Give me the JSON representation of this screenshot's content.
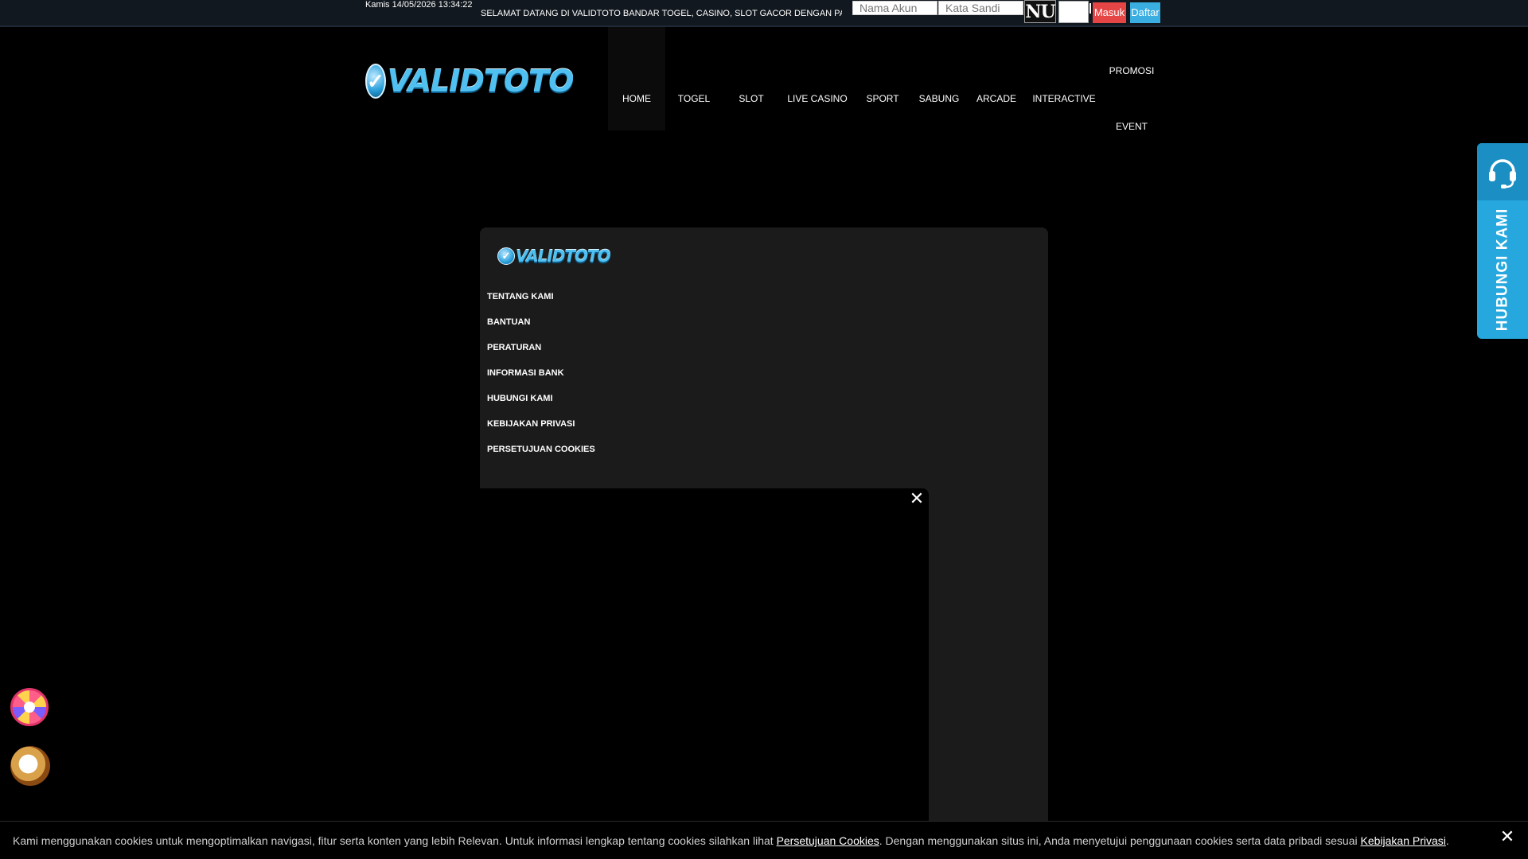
{
  "topbar": {
    "datetime": "Kamis 14/05/2026 13:34:22",
    "datetime_icon": "",
    "announcement": "SELAMAT DATANG DI VALIDTOTO BANDAR TOGEL, CASINO, SLOT GACOR DENGAN PASARAN TERLENGKAP",
    "username_placeholder": "Nama Akun",
    "password_placeholder": "Kata Sandi",
    "captcha_text": "NU",
    "login_label": "Masuk",
    "register_label": "Daftar"
  },
  "brand": {
    "logo_text": "VALIDTOTO"
  },
  "nav": {
    "items": [
      "HOME",
      "TOGEL",
      "SLOT",
      "LIVE CASINO",
      "SPORT",
      "SABUNG",
      "ARCADE",
      "INTERACTIVE",
      "PROMOSI",
      "EVENT"
    ]
  },
  "modal": {
    "logo_text": "VALIDTOTO",
    "menu": [
      "TENTANG KAMI",
      "BANTUAN",
      "PERATURAN",
      "INFORMASI BANK",
      "HUBUNGI KAMI",
      "KEBIJAKAN PRIVASI",
      "PERSETUJUAN COOKIES"
    ],
    "video_close": "✕"
  },
  "contact": {
    "label": "HUBUNGI KAMI",
    "icon": "headset-icon"
  },
  "cookie": {
    "text_1": "Kami menggunakan cookies untuk mengoptimalkan navigasi, fitur serta konten yang lebih Relevan. Untuk informasi lengkap tentang cookies silahkan lihat ",
    "link_1": "Persetujuan Cookies",
    "text_2": ". Dengan menggunakan situs ini, Anda menyetujui penggunaan cookies serta data pribadi sesuai ",
    "link_2": "Kebijakan Privasi",
    "text_3": ".",
    "close": "✕"
  },
  "colors": {
    "accent_blue": "#26a8de",
    "login_red": "#e64545",
    "register_blue": "#3aaee0"
  }
}
